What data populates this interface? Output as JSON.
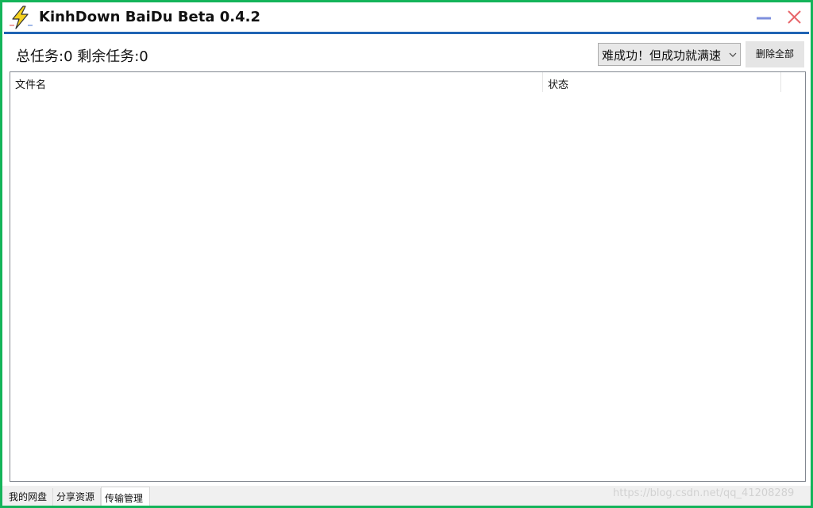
{
  "window": {
    "title": "KinhDown BaiDu Beta 0.4.2",
    "app_icon": "lightning-bolt-icon",
    "minimize_icon": "minimize-icon",
    "close_icon": "close-icon",
    "border_color": "#14b45a",
    "accent_color": "#1f64b4"
  },
  "toolbar": {
    "task_summary": "总任务:0 剩余任务:0",
    "mode_select": {
      "selected": "难成功！但成功就满速"
    },
    "delete_all_label": "删除全部"
  },
  "transfer_list": {
    "columns": [
      "文件名",
      "状态"
    ],
    "rows": []
  },
  "tabs": [
    {
      "label": "我的网盘",
      "active": false
    },
    {
      "label": "分享资源",
      "active": false
    },
    {
      "label": "传输管理",
      "active": true
    }
  ],
  "watermark": "https://blog.csdn.net/qq_41208289"
}
